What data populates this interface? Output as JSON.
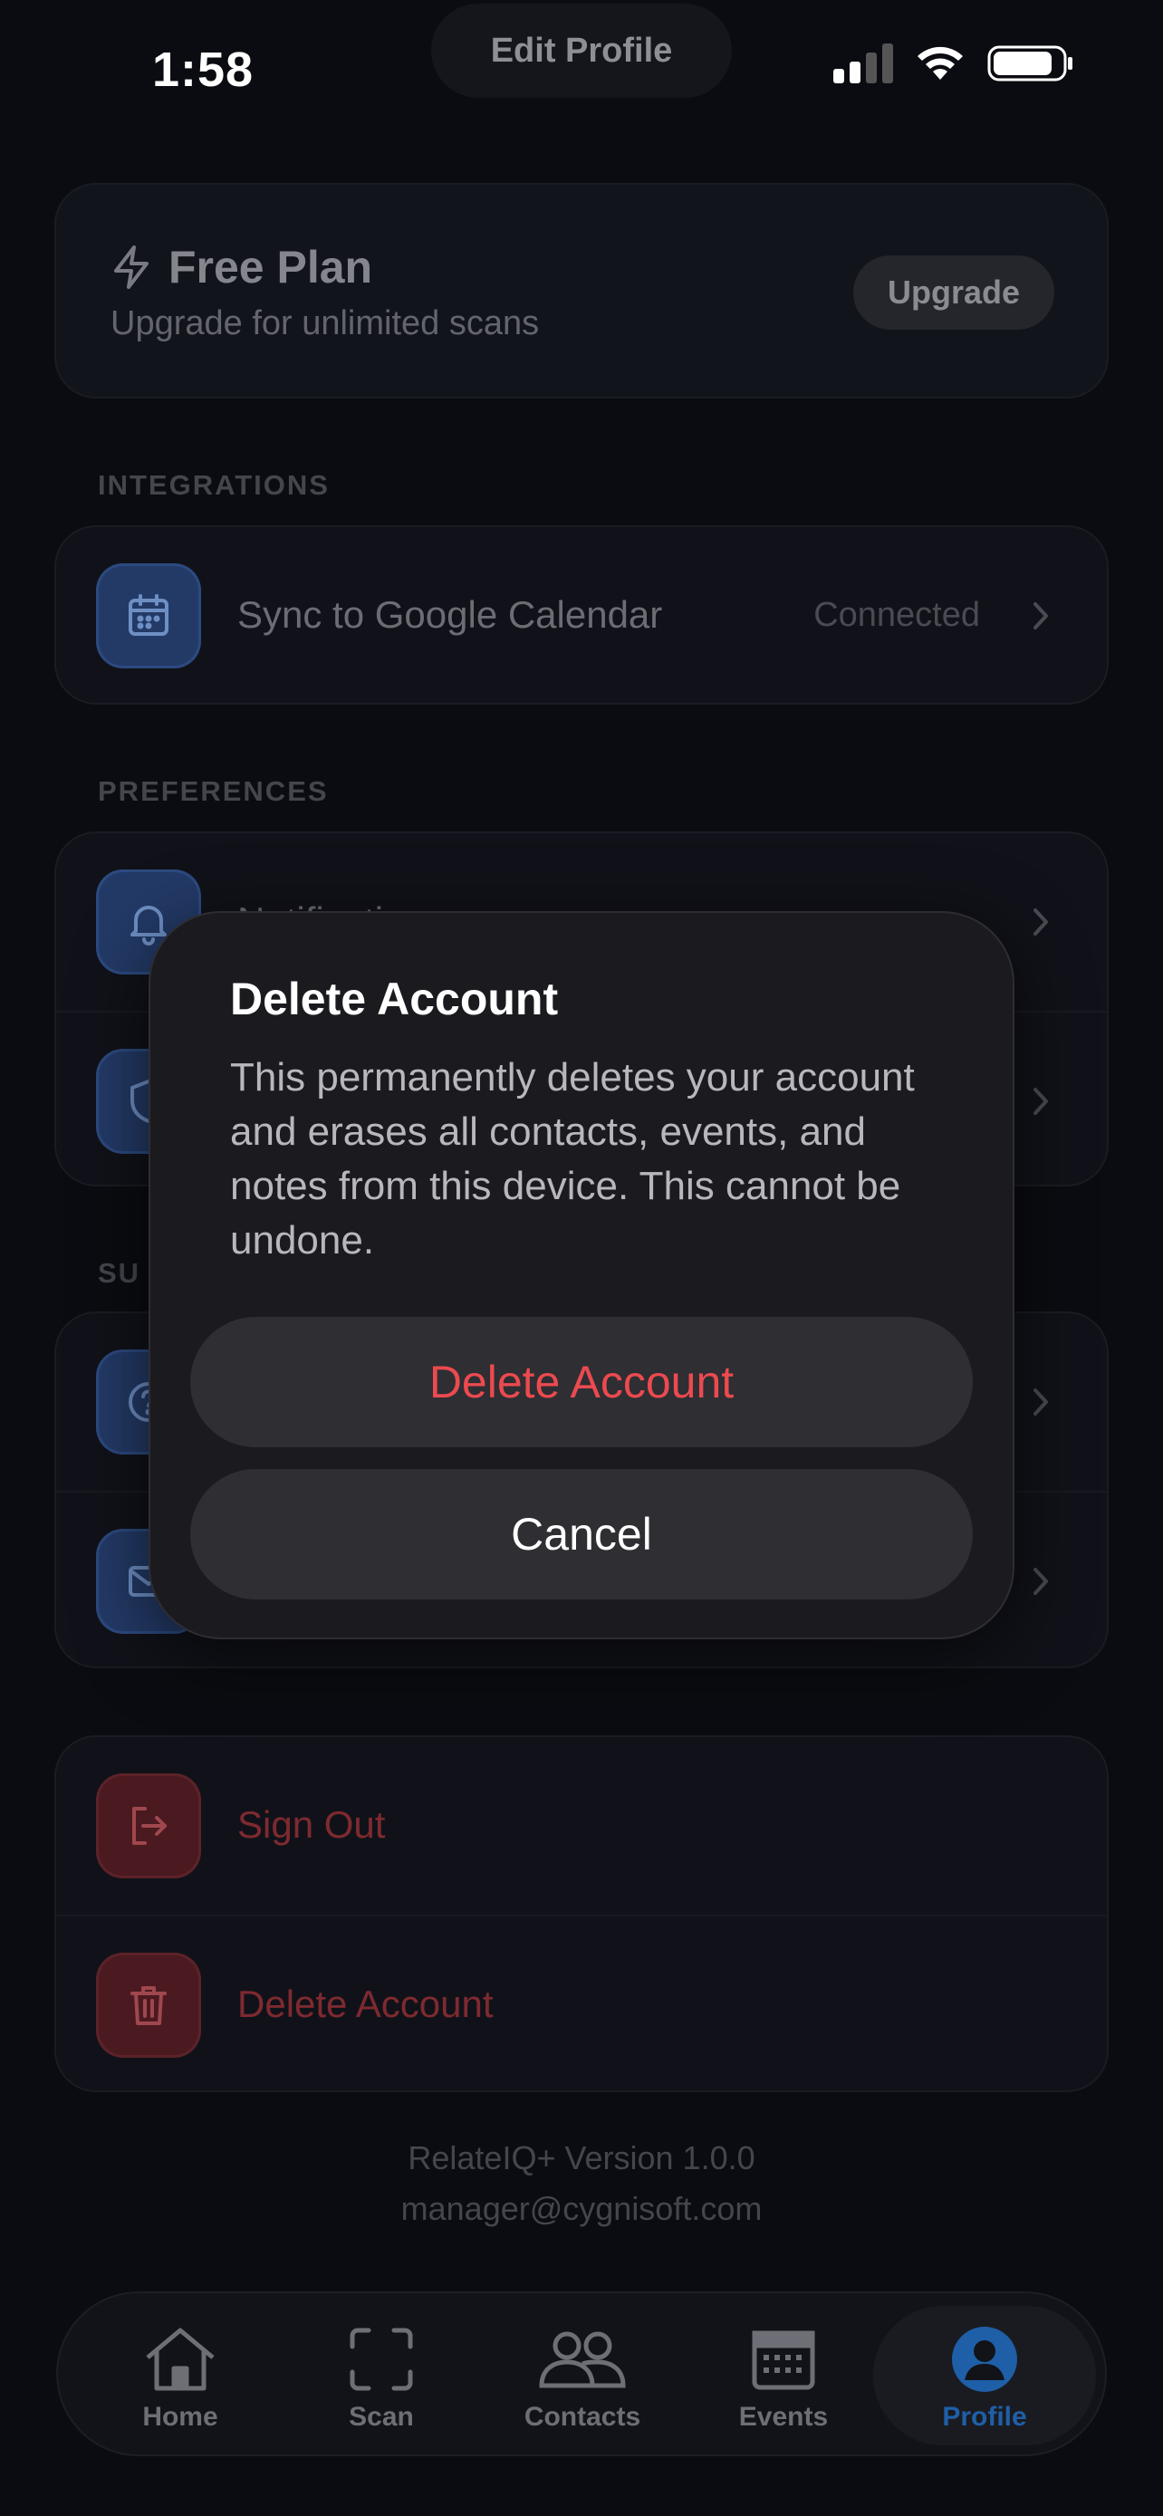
{
  "status_bar": {
    "time": "1:58",
    "title_pill": "Edit Profile"
  },
  "plan": {
    "title": "Free Plan",
    "subtitle": "Upgrade for unlimited scans",
    "upgrade_label": "Upgrade"
  },
  "sections": {
    "integrations": {
      "label": "INTEGRATIONS",
      "items": [
        {
          "label": "Sync to Google Calendar",
          "value": "Connected",
          "icon": "calendar-icon"
        }
      ]
    },
    "preferences": {
      "label": "PREFERENCES",
      "items": [
        {
          "label": "Notificati",
          "icon": "bell-icon"
        },
        {
          "label": "",
          "icon": "shield-icon"
        }
      ]
    },
    "support": {
      "label": "SU",
      "items": [
        {
          "label": "",
          "icon": "help-icon"
        },
        {
          "label": "",
          "icon": "mail-icon"
        }
      ]
    },
    "account": {
      "items": [
        {
          "label": "Sign Out",
          "icon": "sign-out-icon"
        },
        {
          "label": "Delete Account",
          "icon": "trash-icon"
        }
      ]
    }
  },
  "footer": {
    "version": "RelateIQ+ Version 1.0.0",
    "email": "manager@cygnisoft.com"
  },
  "tabs": [
    {
      "label": "Home",
      "icon": "home-icon"
    },
    {
      "label": "Scan",
      "icon": "scan-icon"
    },
    {
      "label": "Contacts",
      "icon": "contacts-icon"
    },
    {
      "label": "Events",
      "icon": "events-icon"
    },
    {
      "label": "Profile",
      "icon": "profile-icon",
      "active": true
    }
  ],
  "modal": {
    "title": "Delete Account",
    "body": "This permanently deletes your account and erases all contacts, events, and notes from this device. This cannot be undone.",
    "confirm_label": "Delete Account",
    "cancel_label": "Cancel"
  },
  "colors": {
    "accent": "#1f5fa8",
    "destructive": "#eb4a4f",
    "background": "#0b0c11"
  }
}
